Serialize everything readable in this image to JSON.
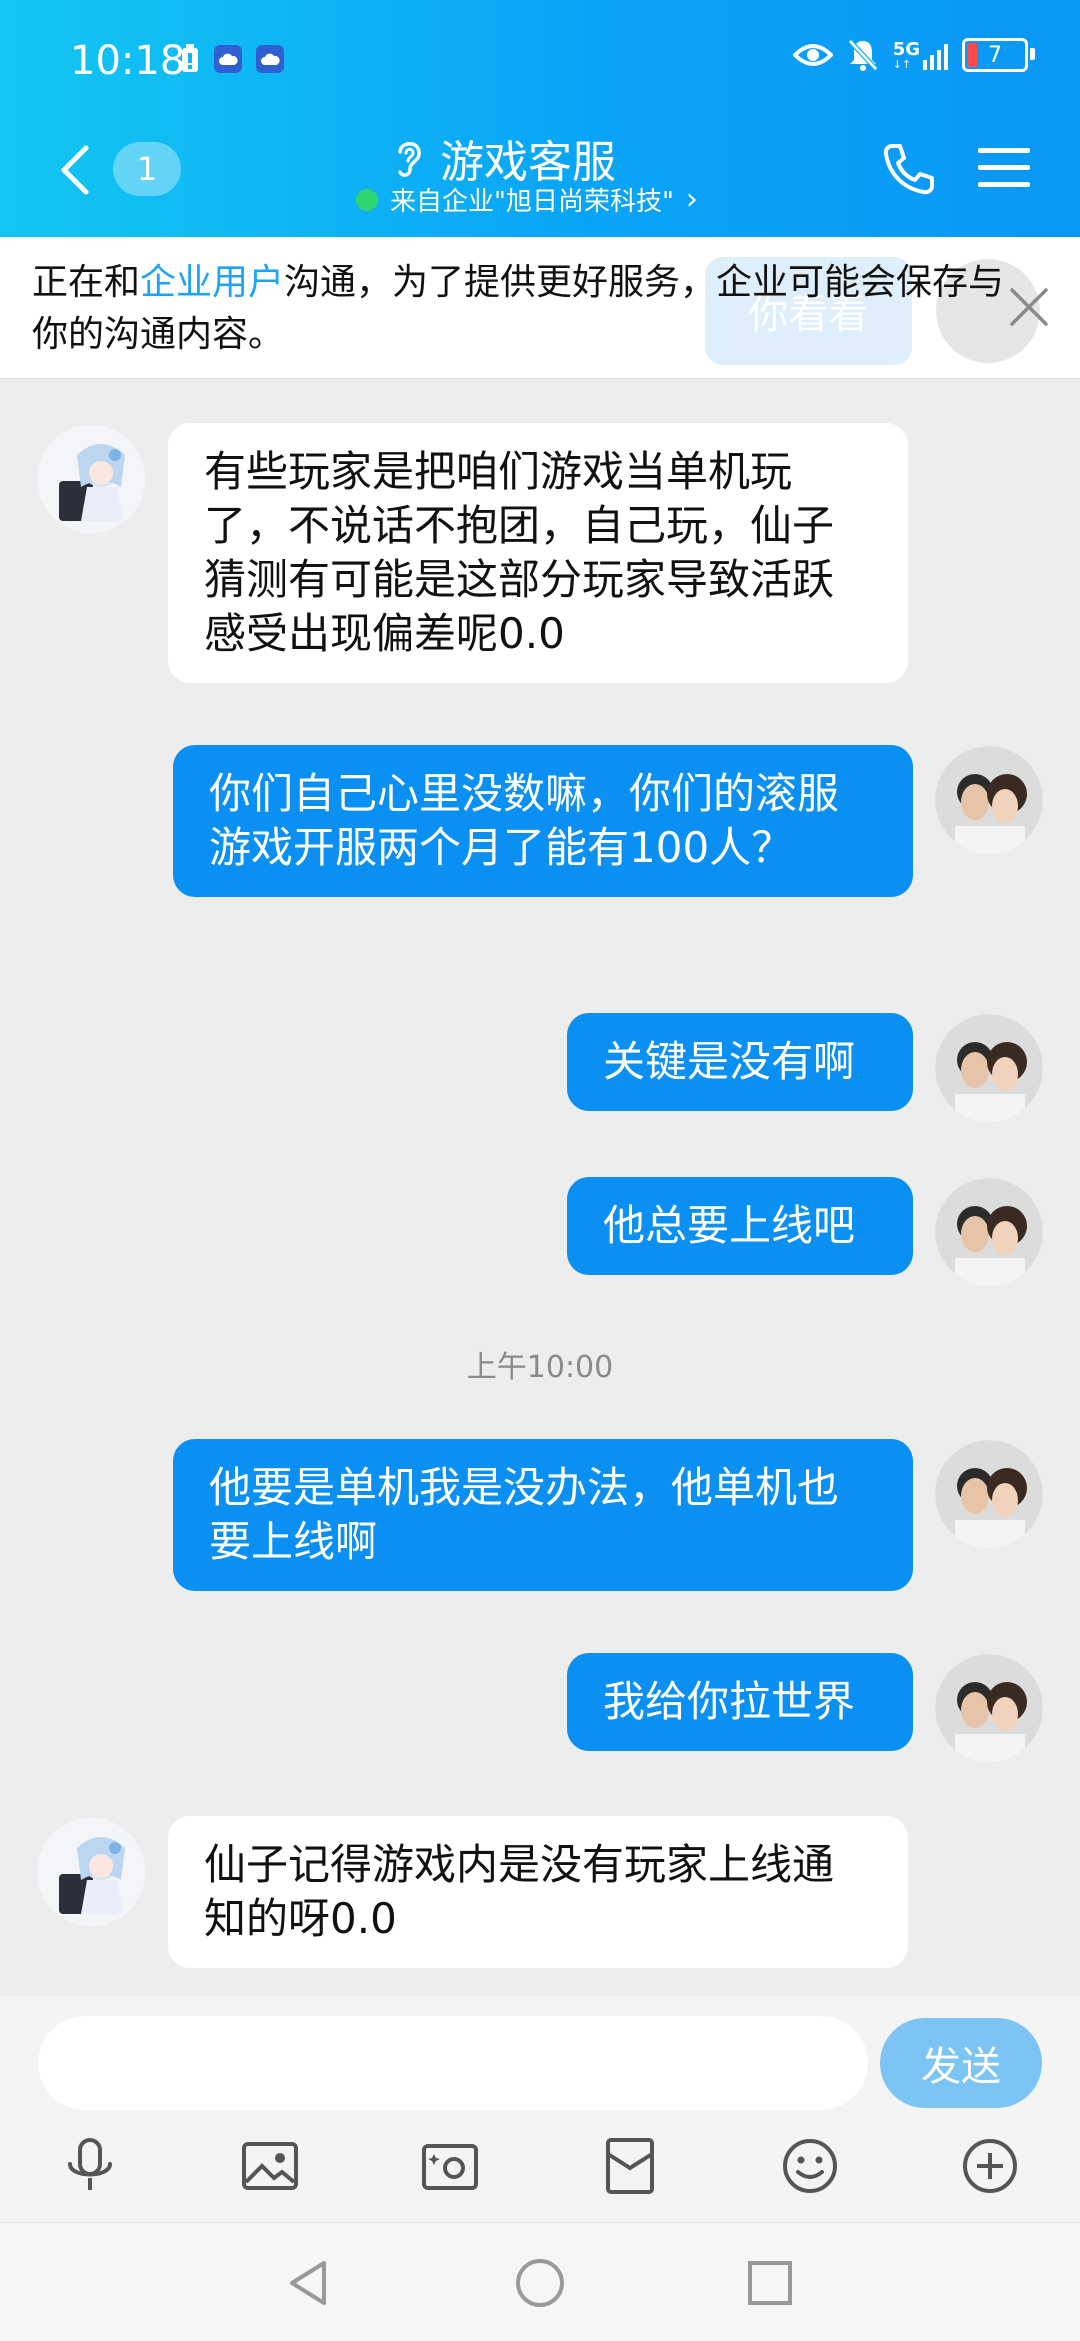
{
  "status_bar": {
    "time": "10:18",
    "network": "5G",
    "battery": "7",
    "icons": [
      "battery-saver-icon",
      "cloud-icon",
      "cloud-icon",
      "eye-icon",
      "bell-off-icon",
      "signal-icon"
    ]
  },
  "header": {
    "unread_count": "1",
    "title": "游戏客服",
    "subtitle": "来自企业\"旭日尚荣科技\"",
    "subtitle_chevron": "›"
  },
  "notice": {
    "prefix": "正在和",
    "link": "企业用户",
    "suffix": "沟通，为了提供更好服务，企业可能会保存与你的沟通内容。",
    "ghost_bubble": "你看看"
  },
  "messages": [
    {
      "direction": "in",
      "text": "有些玩家是把咱们游戏当单机玩了，不说话不抱团，自己玩，仙子猜测有可能是这部分玩家导致活跃感受出现偏差呢0.0"
    },
    {
      "direction": "out",
      "text": "你们自己心里没数嘛，你们的滚服游戏开服两个月了能有100人？"
    },
    {
      "direction": "out",
      "text": "关键是没有啊"
    },
    {
      "direction": "out",
      "text": "他总要上线吧"
    },
    {
      "direction": "out",
      "text": "他要是单机我是没办法，他单机也要上线啊"
    },
    {
      "direction": "out",
      "text": "我给你拉世界"
    },
    {
      "direction": "in",
      "text": "仙子记得游戏内是没有玩家上线通知的呀0.0"
    }
  ],
  "timestamp": "上午10:00",
  "input": {
    "value": "",
    "placeholder": "",
    "send_label": "发送"
  },
  "toolbar": [
    "microphone-icon",
    "image-icon",
    "camera-icon",
    "red-packet-icon",
    "emoji-icon",
    "plus-icon"
  ],
  "colors": {
    "header_gradient_start": "#12c6f2",
    "header_gradient_end": "#0a97f5",
    "outgoing_bubble": "#0a8ff2",
    "incoming_bubble": "#ffffff",
    "link": "#1ea3f5",
    "send_button": "#7cc4f4",
    "chat_background": "#ededed"
  }
}
